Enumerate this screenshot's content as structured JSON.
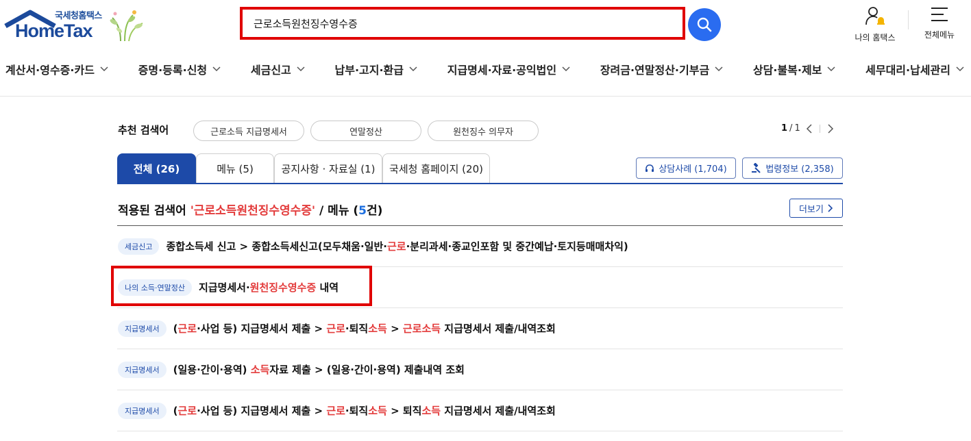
{
  "header": {
    "logo_sub": "국세청홈택스",
    "logo_main": "HomeTax",
    "search": {
      "value": "근로소득원천징수영수증"
    },
    "my_hometax_label": "나의 홈택스",
    "all_menu_label": "전체메뉴"
  },
  "nav": [
    "계산서·영수증·카드",
    "증명·등록·신청",
    "세금신고",
    "납부·고지·환급",
    "지급명세·자료·공익법인",
    "장려금·연말정산·기부금",
    "상담·불복·제보",
    "세무대리·납세관리"
  ],
  "recommended": {
    "label": "추천 검색어",
    "chips": [
      "근로소득 지급명세서",
      "연말정산",
      "원천징수 의무자"
    ],
    "pager": {
      "current": "1",
      "sep": "/",
      "total": "1"
    }
  },
  "tabs": [
    {
      "label": "전체 (26)",
      "active": true
    },
    {
      "label": "메뉴 (5)",
      "active": false
    },
    {
      "label": "공지사항 · 자료실 (1)",
      "active": false
    },
    {
      "label": "국세청 홈페이지 (20)",
      "active": false
    }
  ],
  "side_buttons": {
    "consult": "상담사례 (1,704)",
    "law": "법령정보 (2,358)"
  },
  "result": {
    "prefix": "적용된 검색어 ",
    "keyword": "'근로소득원천징수영수증'",
    "middle": " / 메뉴 (",
    "count": "5",
    "suffix": "건)",
    "more": "더보기"
  },
  "rows": [
    {
      "badge": "세금신고",
      "segments": [
        {
          "text": "종합소득세 신고 > 종합소득세신고(모두채움·일반·",
          "hl": false
        },
        {
          "text": "근로",
          "hl": true
        },
        {
          "text": "·분리과세·종교인포함 및 중간예납·토지등매매차익)",
          "hl": false
        }
      ]
    },
    {
      "badge": "나의 소득·연말정산",
      "segments": [
        {
          "text": "지급명세서·",
          "hl": false
        },
        {
          "text": "원천징수영수증",
          "hl": true
        },
        {
          "text": " 내역",
          "hl": false
        }
      ]
    },
    {
      "badge": "지급명세서",
      "segments": [
        {
          "text": "(",
          "hl": false
        },
        {
          "text": "근로",
          "hl": true
        },
        {
          "text": "·사업 등) 지급명세서 제출 > ",
          "hl": false
        },
        {
          "text": "근로",
          "hl": true
        },
        {
          "text": "·퇴직",
          "hl": false
        },
        {
          "text": "소득",
          "hl": true
        },
        {
          "text": " > ",
          "hl": false
        },
        {
          "text": "근로소득",
          "hl": true
        },
        {
          "text": " 지급명세서 제출/내역조회",
          "hl": false
        }
      ]
    },
    {
      "badge": "지급명세서",
      "segments": [
        {
          "text": "(일용·간이·용역) ",
          "hl": false
        },
        {
          "text": "소득",
          "hl": true
        },
        {
          "text": "자료 제출 > (일용·간이·용역) 제출내역 조회",
          "hl": false
        }
      ]
    },
    {
      "badge": "지급명세서",
      "segments": [
        {
          "text": "(",
          "hl": false
        },
        {
          "text": "근로",
          "hl": true
        },
        {
          "text": "·사업 등) 지급명세서 제출 > ",
          "hl": false
        },
        {
          "text": "근로",
          "hl": true
        },
        {
          "text": "·퇴직",
          "hl": false
        },
        {
          "text": "소득",
          "hl": true
        },
        {
          "text": " > 퇴직",
          "hl": false
        },
        {
          "text": "소득",
          "hl": true
        },
        {
          "text": " 지급명세서 제출/내역조회",
          "hl": false
        }
      ]
    }
  ],
  "colors": {
    "primary": "#1d4aa8",
    "highlight": "#e33b3b",
    "search_button": "#2a6cf0",
    "annotation_box": "#e00000"
  }
}
